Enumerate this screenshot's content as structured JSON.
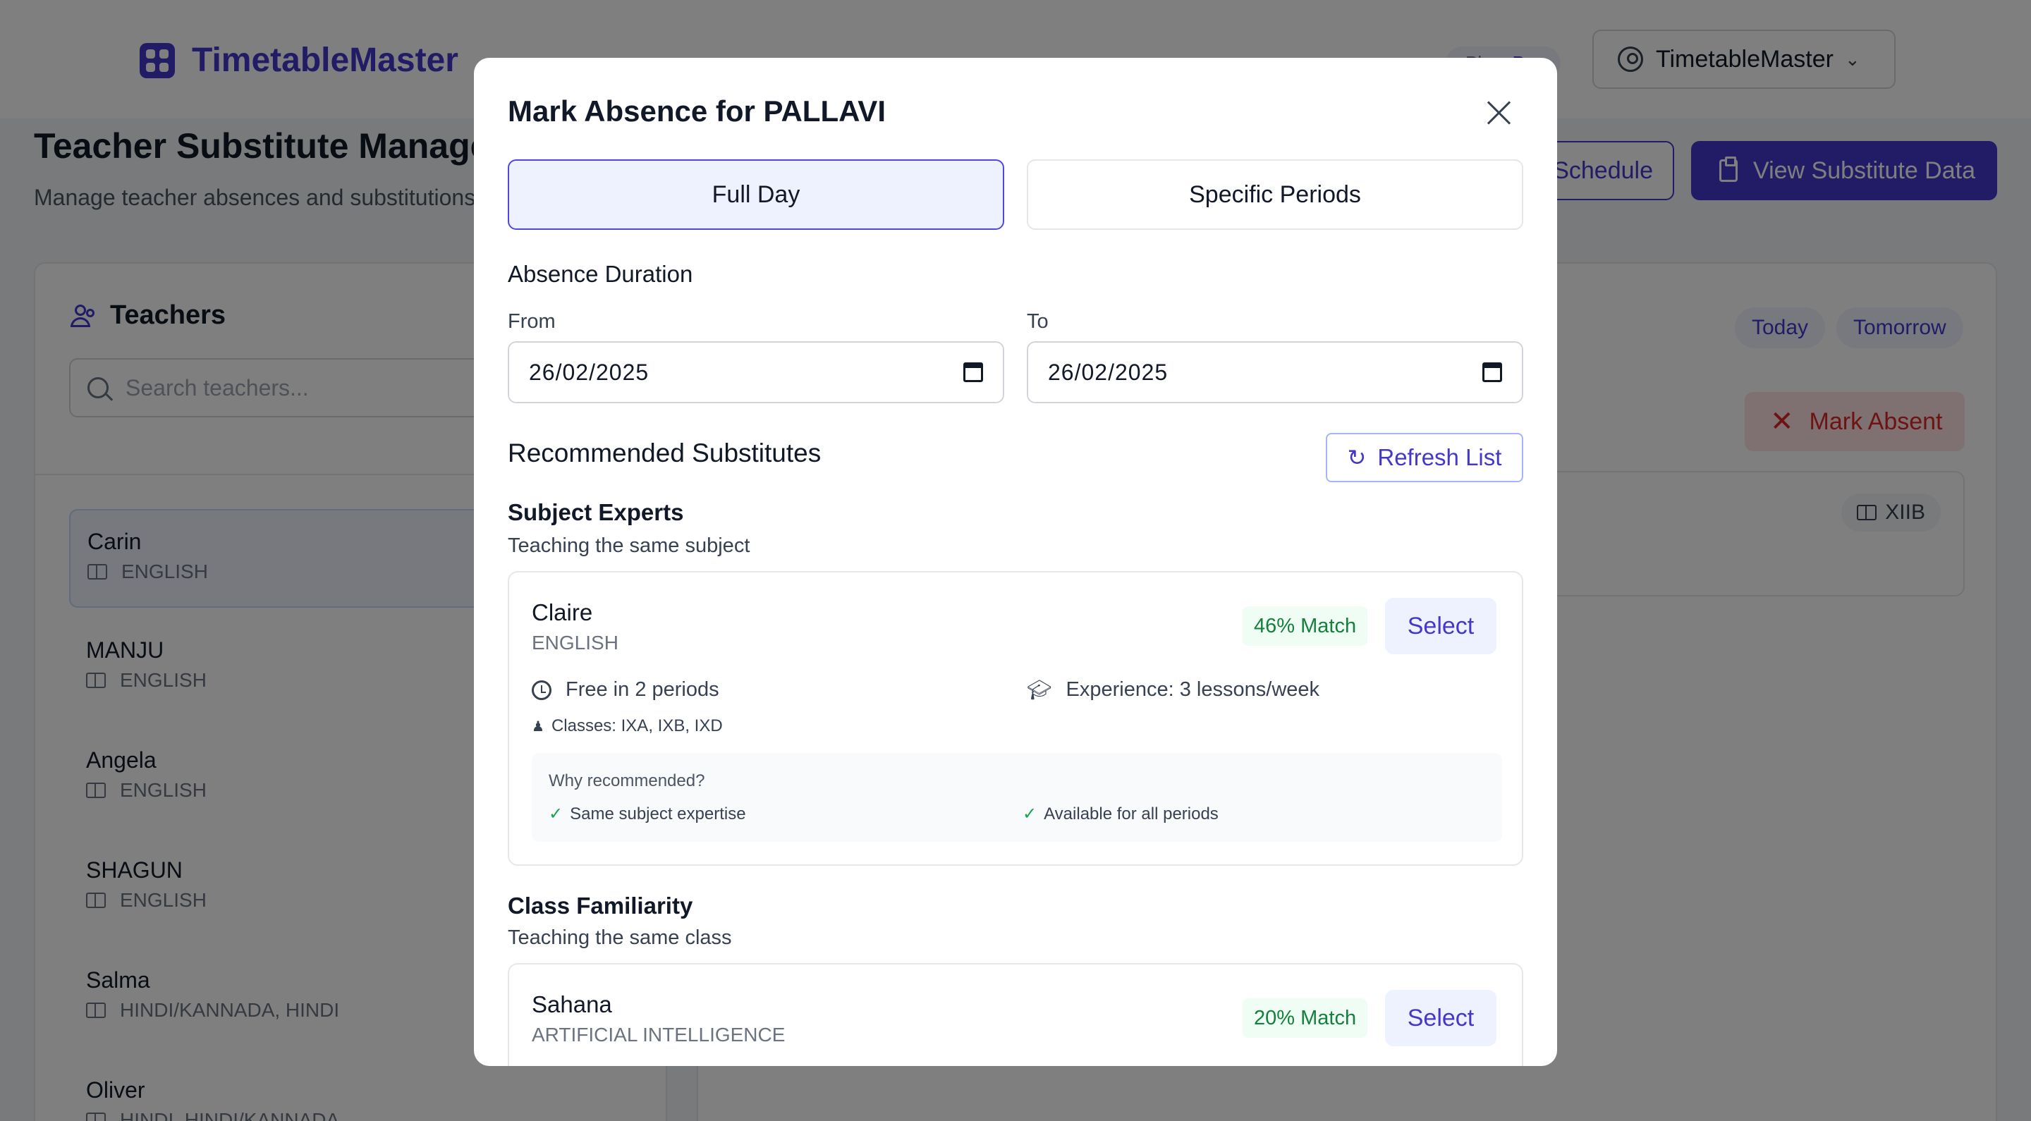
{
  "app": {
    "name": "TimetableMaster",
    "plan_label": "Plan:",
    "plan_value": "Pro",
    "account_label": "TimetableMaster"
  },
  "page": {
    "title": "Teacher Substitute Management",
    "subtitle": "Manage teacher absences and substitutions",
    "schedule_button": "Schedule",
    "view_substitute_button": "View Substitute Data"
  },
  "teachers_panel": {
    "title": "Teachers",
    "search_placeholder": "Search teachers...",
    "teachers": [
      {
        "name": "Carin",
        "subject": "ENGLISH"
      },
      {
        "name": "MANJU",
        "subject": "ENGLISH"
      },
      {
        "name": "Angela",
        "subject": "ENGLISH"
      },
      {
        "name": "SHAGUN",
        "subject": "ENGLISH"
      },
      {
        "name": "Salma",
        "subject": "HINDI/KANNADA, HINDI"
      },
      {
        "name": "Oliver",
        "subject": "HINDI, HINDI/KANNADA"
      }
    ]
  },
  "schedule_panel": {
    "today_label": "Today",
    "tomorrow_label": "Tomorrow",
    "mark_absent_label": "Mark Absent",
    "class_tag": "XIIB"
  },
  "modal": {
    "title": "Mark Absence for PALLAVI",
    "tab_full_day": "Full Day",
    "tab_specific": "Specific Periods",
    "duration_label": "Absence Duration",
    "from_label": "From",
    "from_value": "26/02/2025",
    "to_label": "To",
    "to_value": "26/02/2025",
    "recommended_title": "Recommended Substitutes",
    "refresh_label": "Refresh List",
    "groups": [
      {
        "title": "Subject Experts",
        "subtitle": "Teaching the same subject",
        "candidate": {
          "name": "Claire",
          "subject": "ENGLISH",
          "match": "46% Match",
          "select": "Select",
          "free": "Free in 2 periods",
          "experience": "Experience: 3 lessons/week",
          "classes": "Classes: IXA, IXB, IXD",
          "why_title": "Why recommended?",
          "reasons": [
            "Same subject expertise",
            "Available for all periods"
          ]
        }
      },
      {
        "title": "Class Familiarity",
        "subtitle": "Teaching the same class",
        "candidate": {
          "name": "Sahana",
          "subject": "ARTIFICIAL INTELLIGENCE",
          "match": "20% Match",
          "select": "Select"
        }
      }
    ]
  }
}
